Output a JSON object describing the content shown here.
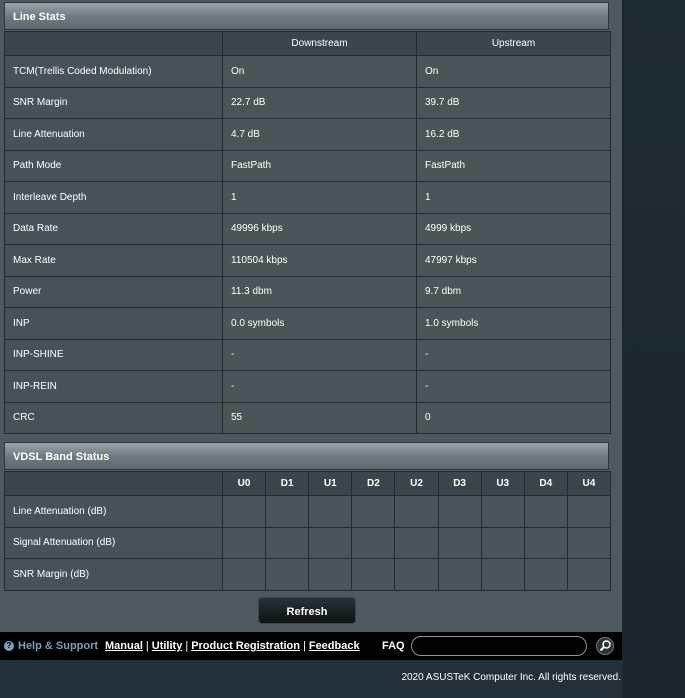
{
  "line_stats": {
    "title": "Line Stats",
    "columns": [
      "",
      "Downstream",
      "Upstream"
    ],
    "rows": [
      {
        "label": "TCM(Trellis Coded Modulation)",
        "down": "On",
        "up": "On"
      },
      {
        "label": "SNR Margin",
        "down": "22.7 dB",
        "up": "39.7 dB"
      },
      {
        "label": "Line Attenuation",
        "down": "4.7 dB",
        "up": "16.2 dB"
      },
      {
        "label": "Path Mode",
        "down": "FastPath",
        "up": "FastPath"
      },
      {
        "label": "Interleave Depth",
        "down": "1",
        "up": "1"
      },
      {
        "label": "Data Rate",
        "down": "49996 kbps",
        "up": "4999 kbps"
      },
      {
        "label": "Max Rate",
        "down": "110504 kbps",
        "up": "47997 kbps"
      },
      {
        "label": "Power",
        "down": "11.3 dbm",
        "up": "9.7 dbm"
      },
      {
        "label": "INP",
        "down": "0.0 symbols",
        "up": "1.0 symbols"
      },
      {
        "label": "INP-SHINE",
        "down": "-",
        "up": "-"
      },
      {
        "label": "INP-REIN",
        "down": "-",
        "up": "-"
      },
      {
        "label": "CRC",
        "down": "55",
        "up": "0"
      }
    ]
  },
  "vdsl_band": {
    "title": "VDSL Band Status",
    "bands": [
      "U0",
      "D1",
      "U1",
      "D2",
      "U2",
      "D3",
      "U3",
      "D4",
      "U4"
    ],
    "rows": [
      {
        "label": "Line Attenuation (dB)"
      },
      {
        "label": "Signal Attenuation (dB)"
      },
      {
        "label": "SNR Margin (dB)"
      }
    ]
  },
  "refresh_label": "Refresh",
  "footer": {
    "help": "Help & Support",
    "links": [
      "Manual",
      "Utility",
      "Product Registration",
      "Feedback"
    ],
    "faq": "FAQ",
    "search_value": ""
  },
  "copyright": "2020 ASUSTeK Computer Inc. All rights reserved."
}
